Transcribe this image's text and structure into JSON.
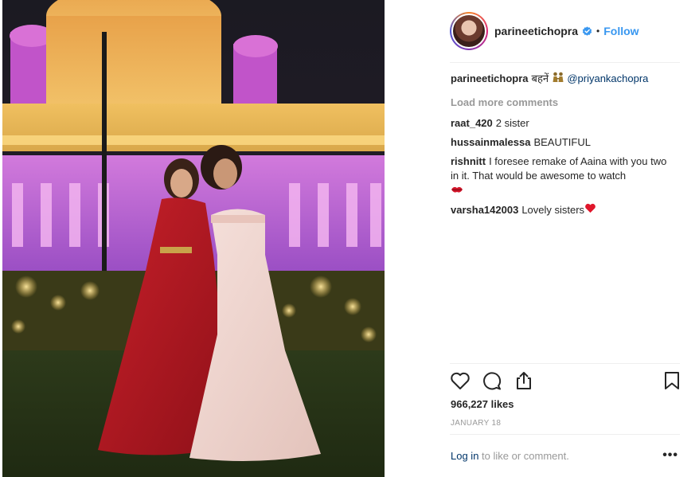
{
  "post": {
    "image_alt": "Two women posing in front of illuminated palace",
    "header": {
      "username": "parineetichopra",
      "verified_icon": "verified-badge-icon",
      "separator": "•",
      "follow_label": "Follow"
    },
    "caption": {
      "username": "parineetichopra",
      "text": "बहनें",
      "emoji": "women-holding-hands-emoji",
      "mention": "@priyankachopra"
    },
    "load_more_label": "Load more comments",
    "comments": [
      {
        "username": "raat_420",
        "text": "2 sister"
      },
      {
        "username": "hussainmalessa",
        "text": "BEAUTIFUL"
      },
      {
        "username": "rishnitt",
        "text": "I foresee remake of Aaina with you two in it. That would be awesome to watch",
        "emoji": "lips-emoji"
      },
      {
        "username": "varsha142003",
        "text": "Lovely sisters",
        "emoji": "red-heart-emoji"
      }
    ],
    "actions": [
      "heart-icon",
      "comment-icon",
      "share-icon",
      "bookmark-icon"
    ],
    "likes": "966,227 likes",
    "date": "JANUARY 18",
    "footer": {
      "login_label": "Log in",
      "login_suffix": " to like or comment.",
      "more_label": "•••"
    },
    "colors": {
      "link_blue": "#3897f0",
      "mention_blue": "#003569",
      "muted": "#999999",
      "text": "#262626"
    }
  }
}
